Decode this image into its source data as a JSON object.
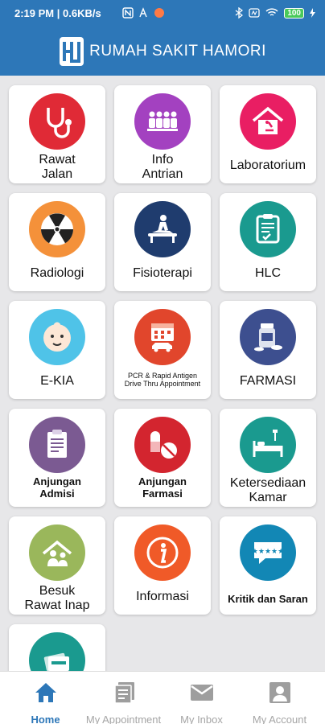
{
  "status_bar": {
    "time_speed": "2:19 PM | 0.6KB/s",
    "battery": "100"
  },
  "header": {
    "title": "RUMAH SAKIT HAMORI"
  },
  "menu": [
    {
      "label": "Rawat\nJalan",
      "icon": "stethoscope-icon",
      "color": "#e02a36"
    },
    {
      "label": "Info\nAntrian",
      "icon": "queue-icon",
      "color": "#a341c0"
    },
    {
      "label": "Laboratorium",
      "icon": "microscope-house-icon",
      "color": "#e91e63"
    },
    {
      "label": "Radiologi",
      "icon": "radiation-icon",
      "color": "#f4913a"
    },
    {
      "label": "Fisioterapi",
      "icon": "massage-icon",
      "color": "#1f3c6e"
    },
    {
      "label": "HLC",
      "icon": "clipboard-check-icon",
      "color": "#1a9a8f"
    },
    {
      "label": "E-KIA",
      "icon": "baby-face-icon",
      "color": "#4fc3e8"
    },
    {
      "label": "PCR & Rapid Antigen\nDrive Thru Appointment",
      "icon": "calendar-car-icon",
      "color": "#e1462c"
    },
    {
      "label": "FARMASI",
      "icon": "medicine-bottle-icon",
      "color": "#3d4f8f"
    },
    {
      "label": "Anjungan\nAdmisi",
      "icon": "form-clipboard-icon",
      "color": "#7b5a92"
    },
    {
      "label": "Anjungan\nFarmasi",
      "icon": "pills-icon",
      "color": "#d3252f"
    },
    {
      "label": "Ketersediaan\nKamar",
      "icon": "hospital-bed-icon",
      "color": "#1a9a8f"
    },
    {
      "label": "Besuk\nRawat Inap",
      "icon": "visit-family-icon",
      "color": "#9ab75b"
    },
    {
      "label": "Informasi",
      "icon": "info-icon",
      "color": "#f05a28"
    },
    {
      "label": "Kritik dan Saran",
      "icon": "chat-stars-icon",
      "color": "#1287b5"
    },
    {
      "label": "",
      "icon": "member-card-icon",
      "color": "#1a9a8f"
    }
  ],
  "bottom_nav": [
    {
      "label": "Home",
      "icon": "home-icon",
      "active": true
    },
    {
      "label": "My Appointment",
      "icon": "appointment-icon",
      "active": false
    },
    {
      "label": "My Inbox",
      "icon": "mail-icon",
      "active": false
    },
    {
      "label": "My Account",
      "icon": "account-icon",
      "active": false
    }
  ],
  "colors": {
    "primary": "#2d77b8",
    "nav_inactive": "#a5a5a5"
  }
}
